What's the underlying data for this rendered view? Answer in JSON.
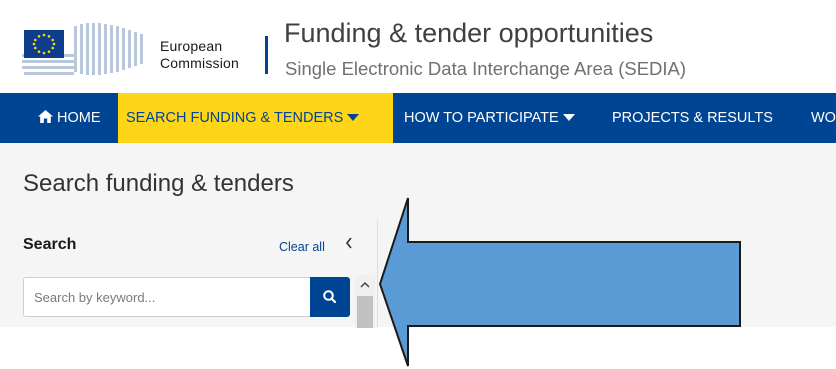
{
  "header": {
    "ec_line1": "European",
    "ec_line2": "Commission",
    "title": "Funding & tender opportunities",
    "subtitle": "Single Electronic Data Interchange Area (SEDIA)"
  },
  "nav": {
    "items": [
      {
        "label": "HOME"
      },
      {
        "label": "SEARCH FUNDING & TENDERS",
        "active": true
      },
      {
        "label": "HOW TO PARTICIPATE"
      },
      {
        "label": "PROJECTS & RESULTS"
      },
      {
        "label": "WO"
      }
    ]
  },
  "main": {
    "page_title": "Search funding & tenders",
    "search_panel": {
      "title": "Search",
      "clear_all": "Clear all",
      "placeholder": "Search by keyword..."
    }
  },
  "colors": {
    "primary": "#004494",
    "accent": "#ffd617",
    "arrow_fill": "#5b9bd5"
  }
}
